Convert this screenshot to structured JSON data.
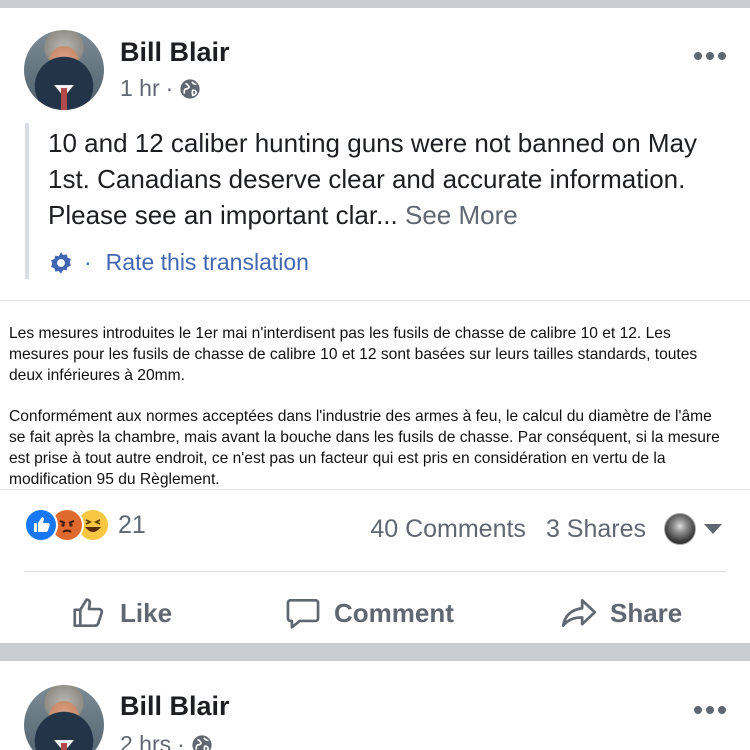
{
  "post1": {
    "author": "Bill Blair",
    "time": "1 hr",
    "meta_dot": "·",
    "text": "10 and 12 caliber hunting guns were not banned on May 1st. Canadians deserve clear and accurate information. Please see an important clar...",
    "see_more": "See More",
    "translation_dot": "·",
    "rate_translation": "Rate this translation",
    "doc_paragraph_1": "Les mesures introduites le 1er mai n'interdisent pas les fusils de chasse de calibre 10 et 12.  Les mesures pour les fusils de chasse de calibre 10 et 12 sont basées sur leurs tailles standards, toutes deux inférieures à 20mm.",
    "doc_paragraph_2": "Conformément aux normes acceptées dans l'industrie des armes à feu, le calcul du diamètre de l'âme se fait après la chambre, mais avant la bouche dans les fusils de chasse. Par conséquent, si la mesure est prise à tout autre endroit, ce n'est pas un facteur qui est pris en considération en vertu de la modification 95 du Règlement.",
    "reactions": {
      "count": "21",
      "types": [
        "like-icon",
        "angry-icon",
        "haha-icon"
      ]
    },
    "comments": "40 Comments",
    "shares": "3 Shares",
    "actions": {
      "like": "Like",
      "comment": "Comment",
      "share": "Share"
    }
  },
  "post2": {
    "author": "Bill Blair",
    "time": "2 hrs",
    "meta_dot": "·"
  },
  "colors": {
    "link_blue": "#4267b2",
    "secondary_text": "#606770",
    "separator": "#c9ccd1"
  }
}
